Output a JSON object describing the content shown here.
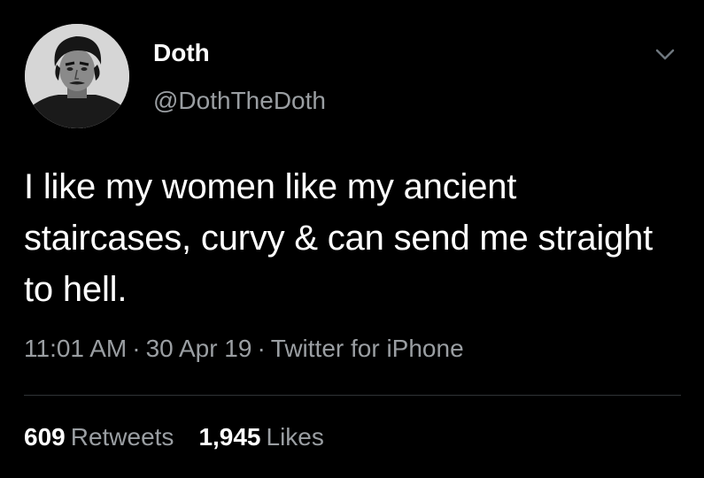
{
  "user": {
    "display_name": "Doth",
    "handle": "@DothTheDoth"
  },
  "tweet": {
    "text": "I like my women like my ancient staircases, curvy & can send me straight to hell.",
    "time": "11:01 AM",
    "date": "30 Apr 19",
    "source": "Twitter for iPhone",
    "separator": "·"
  },
  "stats": {
    "retweets_count": "609",
    "retweets_label": "Retweets",
    "likes_count": "1,945",
    "likes_label": "Likes"
  },
  "icons": {
    "menu": "chevron-down-icon"
  },
  "colors": {
    "background": "#000000",
    "primary_text": "#ffffff",
    "secondary_text": "#9a9ea2",
    "divider": "#2f3336"
  }
}
